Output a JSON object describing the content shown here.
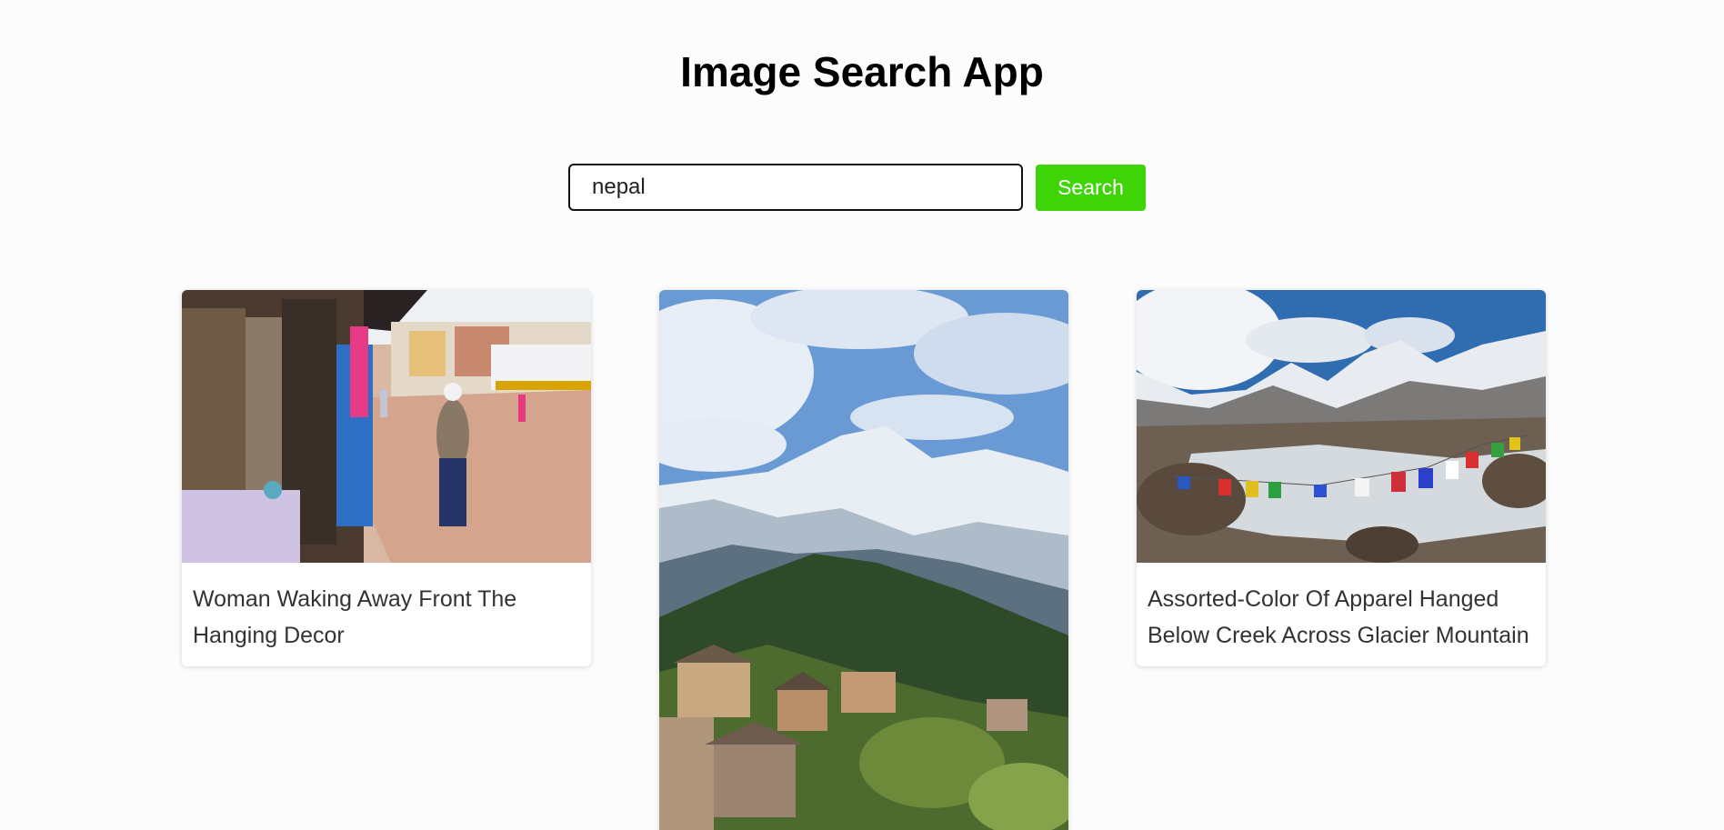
{
  "app": {
    "title": "Image Search App"
  },
  "search": {
    "value": "nepal",
    "button_label": "Search"
  },
  "results": [
    {
      "caption": "Woman Waking Away Front The Hanging Decor",
      "image": "market-street-photo"
    },
    {
      "caption": "",
      "image": "mountain-village-photo"
    },
    {
      "caption": "Assorted-Color Of Apparel Hanged Below Creek Across Glacier Mountain",
      "image": "glacier-prayer-flags-photo"
    }
  ],
  "colors": {
    "accent": "#3fd408",
    "background": "#fcfcfc"
  }
}
